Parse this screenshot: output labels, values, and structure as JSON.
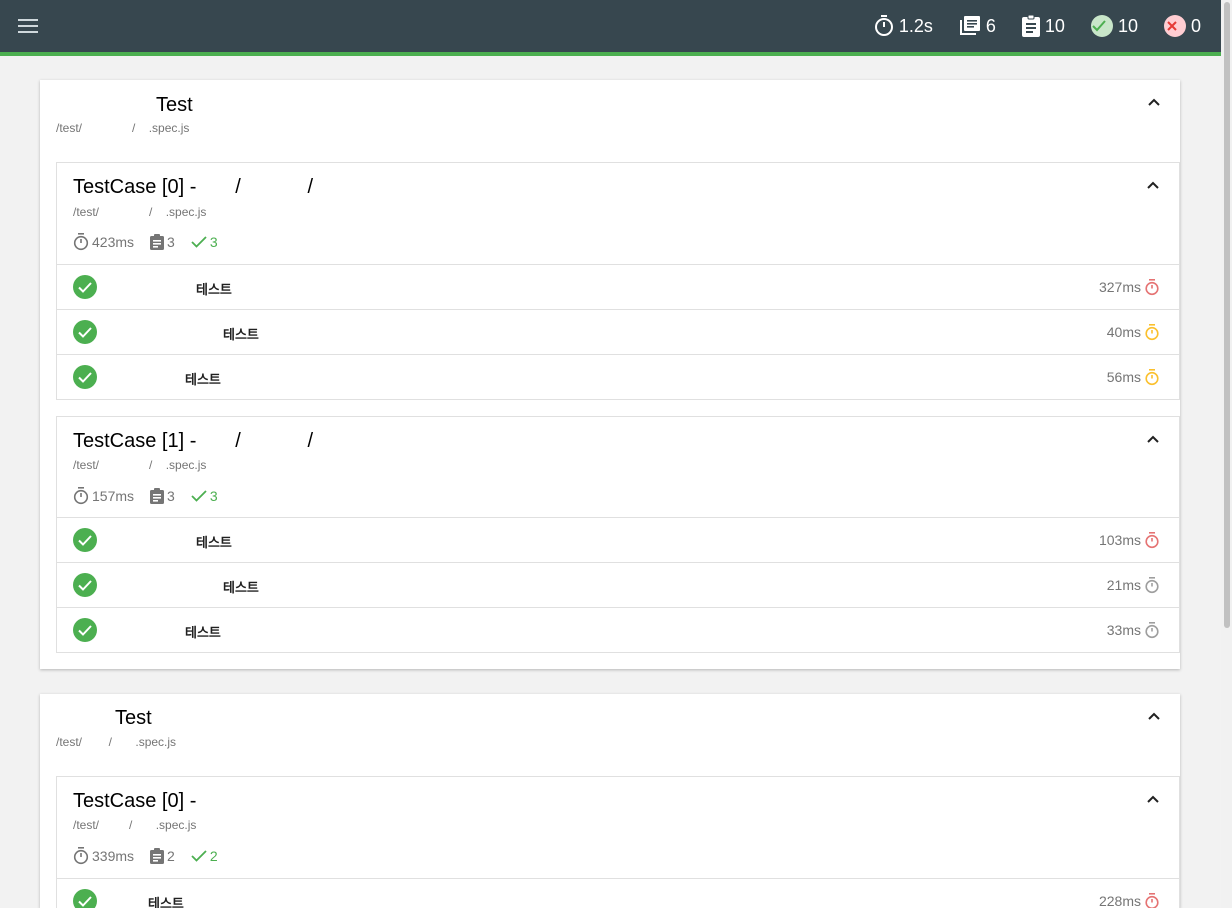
{
  "topbar": {
    "duration": "1.2s",
    "suites": "6",
    "tests": "10",
    "passed": "10",
    "failed": "0",
    "colors": {
      "bar": "#37474f",
      "accent": "#4caf50"
    }
  },
  "suites": [
    {
      "title": "Test",
      "path": "/test/               /    .spec.js",
      "cases": [
        {
          "title": "TestCase [0] -       /            /",
          "path": "/test/               /    .spec.js",
          "duration": "423ms",
          "tests": "3",
          "passed": "3",
          "rows": [
            {
              "name": "테스트",
              "duration": "327ms",
              "timer_color": "#e57373"
            },
            {
              "name": "테스트",
              "duration": "40ms",
              "timer_color": "#fbc02d"
            },
            {
              "name": "테스트",
              "duration": "56ms",
              "timer_color": "#fbc02d"
            }
          ]
        },
        {
          "title": "TestCase [1] -       /            /",
          "path": "/test/               /    .spec.js",
          "duration": "157ms",
          "tests": "3",
          "passed": "3",
          "rows": [
            {
              "name": "테스트",
              "duration": "103ms",
              "timer_color": "#e57373"
            },
            {
              "name": "테스트",
              "duration": "21ms",
              "timer_color": "#9e9e9e"
            },
            {
              "name": "테스트",
              "duration": "33ms",
              "timer_color": "#9e9e9e"
            }
          ]
        }
      ]
    },
    {
      "title": "Test",
      "path": "/test/        /       .spec.js",
      "cases": [
        {
          "title": "TestCase [0] -",
          "path": "/test/         /       .spec.js",
          "duration": "339ms",
          "tests": "2",
          "passed": "2",
          "rows": [
            {
              "name": "테스트",
              "duration": "228ms",
              "timer_color": "#e57373"
            }
          ]
        }
      ]
    }
  ]
}
